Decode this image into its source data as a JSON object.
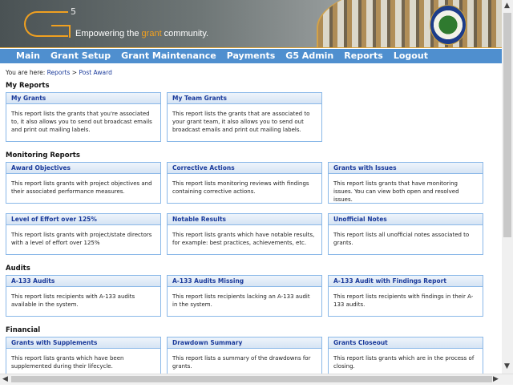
{
  "header": {
    "logo_sup": "5",
    "tagline_pre": "Empowering the ",
    "tagline_accent": "grant",
    "tagline_post": " community.",
    "seal_text": "Department of Education"
  },
  "nav": [
    "Main",
    "Grant Setup",
    "Grant Maintenance",
    "Payments",
    "G5 Admin",
    "Reports",
    "Logout"
  ],
  "breadcrumb": {
    "prefix": "You are here: ",
    "items": [
      "Reports",
      "Post Award"
    ],
    "sep": " > "
  },
  "sections": [
    {
      "title": "My Reports",
      "rows": [
        [
          {
            "title": "My Grants",
            "desc": "This report lists the grants that you're associated to, it also allows you to send out broadcast emails and print out mailing labels."
          },
          {
            "title": "My Team Grants",
            "desc": "This report lists the grants that are associated to your grant team, it also allows you to send out broadcast emails and print out mailing labels."
          }
        ]
      ]
    },
    {
      "title": "Monitoring Reports",
      "rows": [
        [
          {
            "title": "Award Objectives",
            "desc": "This report lists grants with project objectives and their associated performance measures."
          },
          {
            "title": "Corrective Actions",
            "desc": "This report lists monitoring reviews with findings containing corrective actions."
          },
          {
            "title": "Grants with Issues",
            "desc": "This report lists grants that have monitoring issues. You can view both open and resolved issues."
          }
        ],
        [
          {
            "title": "Level of Effort over 125%",
            "desc": "This report lists grants with project/state directors with a level of effort over 125%"
          },
          {
            "title": "Notable Results",
            "desc": "This report lists grants which have notable results, for example: best practices, achievements, etc."
          },
          {
            "title": "Unofficial Notes",
            "desc": "This report lists all unofficial notes associated to grants."
          }
        ]
      ]
    },
    {
      "title": "Audits",
      "rows": [
        [
          {
            "title": "A-133 Audits",
            "desc": "This report lists recipients with A-133 audits available in the system."
          },
          {
            "title": "A-133 Audits Missing",
            "desc": "This report lists recipients lacking an A-133 audit in the system."
          },
          {
            "title": "A-133 Audit with Findings Report",
            "desc": "This report lists recipients with findings in their A-133 audits."
          }
        ]
      ]
    },
    {
      "title": "Financial",
      "rows": [
        [
          {
            "title": "Grants with Supplements",
            "desc": "This report lists grants which have been supplemented during their lifecycle."
          },
          {
            "title": "Drawdown Summary",
            "desc": "This report lists a summary of the drawdowns for grants."
          },
          {
            "title": "Grants Closeout",
            "desc": "This report lists grants which are in the process of closing."
          }
        ]
      ]
    }
  ]
}
